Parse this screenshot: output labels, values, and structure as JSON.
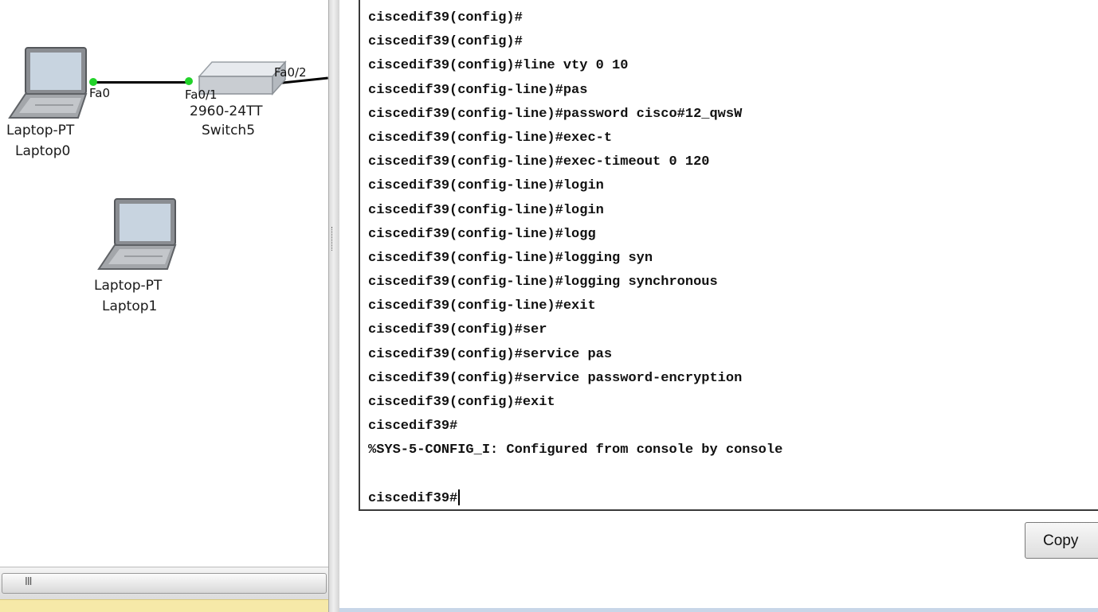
{
  "topology": {
    "laptop0": {
      "type_label": "Laptop-PT",
      "name_label": "Laptop0",
      "port": "Fa0"
    },
    "switch5": {
      "model_label": "2960-24TT",
      "name_label": "Switch5",
      "port_a": "Fa0/1",
      "port_b": "Fa0/2"
    },
    "laptop1": {
      "type_label": "Laptop-PT",
      "name_label": "Laptop1"
    },
    "link_colors": {
      "up": "#22d32a",
      "down": "#e0141c"
    }
  },
  "scrollbar": {
    "grip": "III"
  },
  "terminal": {
    "lines": [
      "ciscedif39(config)#",
      "ciscedif39(config)#",
      "ciscedif39(config)#line vty 0 10",
      "ciscedif39(config-line)#pas",
      "ciscedif39(config-line)#password cisco#12_qwsW",
      "ciscedif39(config-line)#exec-t",
      "ciscedif39(config-line)#exec-timeout 0 120",
      "ciscedif39(config-line)#login",
      "ciscedif39(config-line)#login",
      "ciscedif39(config-line)#logg",
      "ciscedif39(config-line)#logging syn",
      "ciscedif39(config-line)#logging synchronous",
      "ciscedif39(config-line)#exit",
      "ciscedif39(config)#ser",
      "ciscedif39(config)#service pas",
      "ciscedif39(config)#service password-encryption",
      "ciscedif39(config)#exit",
      "ciscedif39#",
      "%SYS-5-CONFIG_I: Configured from console by console",
      "",
      "ciscedif39#"
    ]
  },
  "buttons": {
    "copy_label": "Copy"
  }
}
